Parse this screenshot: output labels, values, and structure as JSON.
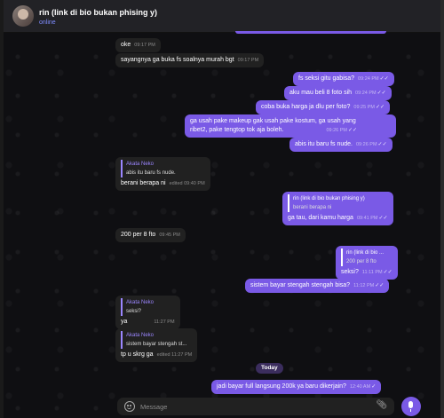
{
  "header": {
    "title": "rin (link di bio bukan phising y)",
    "status": "online"
  },
  "colors": {
    "accent": "#7a5ae6",
    "incoming": "#212121",
    "background": "#0f0f12"
  },
  "messages": [
    {
      "text": "oke",
      "time": "09:17 PM"
    },
    {
      "text": "sayangnya ga buka fs soalnya murah bgt",
      "time": "09:17 PM"
    },
    {
      "text": "fs seksi gitu gabisa?",
      "time": "09:24 PM"
    },
    {
      "text": "aku mau beli 8 foto sih",
      "time": "09:24 PM"
    },
    {
      "text": "coba buka harga ja dlu per foto?",
      "time": "09:25 PM"
    },
    {
      "text_line1": "ga usah pake makeup gak usah pake kostum, ga usah yang",
      "text_line2": "ribet2, pake tengtop tok aja boleh.",
      "time": "09:26 PM"
    },
    {
      "text": "abis itu baru fs nude.",
      "time": "09:26 PM"
    },
    {
      "reply_name": "Akata Neko",
      "reply_text": "abis itu baru fs nude.",
      "text": "berani berapa ni",
      "time": "edited 09:40 PM"
    },
    {
      "reply_name": "rin (link di bio bukan phising y)",
      "reply_text": "berani berapa ni",
      "text": "ga tau, dari kamu harga",
      "time": "09:41 PM"
    },
    {
      "text": "200 per 8 fto",
      "time": "09:45 PM"
    },
    {
      "reply_name": "rin (link di bio ...",
      "reply_text": "200 per 8 fto",
      "text": "seksi?",
      "time": "11:11 PM"
    },
    {
      "text": "sistem bayar stengah stengah bisa?",
      "time": "11:12 PM"
    },
    {
      "reply_name": "Akata Neko",
      "reply_text": "seksi?",
      "text": "ya",
      "time": "11:27 PM"
    },
    {
      "reply_name": "Akata Neko",
      "reply_text": "sistem bayar stengah st...",
      "text": "tp u skrg ga",
      "time": "edited 11:27 PM"
    },
    {
      "text": "jadi bayar full langsung 200k ya baru dikerjain?",
      "time": "12:40 AM"
    }
  ],
  "date_separator": "Today",
  "composer": {
    "placeholder": "Message"
  },
  "icons": {
    "emoji": "emoji-icon",
    "attach": "paperclip-icon",
    "mic": "microphone-icon"
  }
}
